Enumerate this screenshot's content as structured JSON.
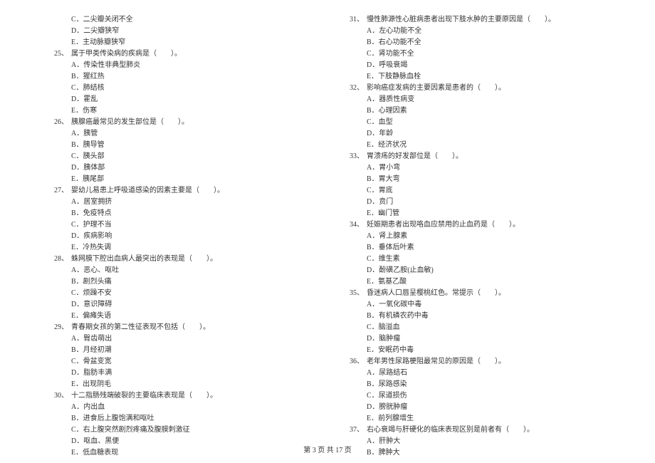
{
  "left": {
    "preOptions": [
      "C．二尖瓣关闭不全",
      "D．二尖瓣狭窄",
      "E．主动脉瓣狭窄"
    ],
    "questions": [
      {
        "num": "25、",
        "stem": "属于甲类传染病的疾病是（　　）。",
        "opts": [
          "A．传染性非典型肺炎",
          "B．猩红热",
          "C．肺结核",
          "D．霍乱",
          "E．伤寒"
        ]
      },
      {
        "num": "26、",
        "stem": "胰腺癌最常见的发生部位是（　　）。",
        "opts": [
          "A．胰管",
          "B．胰导管",
          "C．胰头部",
          "D．胰体部",
          "E．胰尾部"
        ]
      },
      {
        "num": "27、",
        "stem": "婴幼儿易患上呼吸道感染的因素主要是（　　）。",
        "opts": [
          "A．居室拥挤",
          "B．免疫特点",
          "C．护理不当",
          "D．疾病影响",
          "E．冷热失调"
        ]
      },
      {
        "num": "28、",
        "stem": "蛛网膜下腔出血病人最突出的表现是（　　）。",
        "opts": [
          "A．恶心、呕吐",
          "B．剧烈头痛",
          "C．烦躁不安",
          "D．意识障碍",
          "E．偏瘫失语"
        ]
      },
      {
        "num": "29、",
        "stem": "青春期女孩的第二性征表现不包括（　　）。",
        "opts": [
          "A．臀齿萌出",
          "B．月经初潮",
          "C．骨盆变宽",
          "D．脂肪丰满",
          "E．出现阴毛"
        ]
      },
      {
        "num": "30、",
        "stem": "十二指肠残端破裂的主要临床表现是（　　）。",
        "opts": [
          "A．内出血",
          "B．进食后上腹饱满和呕吐",
          "C．右上腹突然剧烈疼痛及腹膜刺激征",
          "D．呕血、黑便",
          "E．低血糖表现"
        ]
      }
    ]
  },
  "right": {
    "questions": [
      {
        "num": "31、",
        "stem": "慢性肺源性心脏病患者出现下肢水肿的主要原因是（　　）。",
        "opts": [
          "A．左心功能不全",
          "B．右心功能不全",
          "C．肾功能不全",
          "D．呼吸衰竭",
          "E．下肢静脉血栓"
        ]
      },
      {
        "num": "32、",
        "stem": "影响癌症发病的主要因素是患者的（　　）。",
        "opts": [
          "A．器质性病变",
          "B．心理因素",
          "C．血型",
          "D．年龄",
          "E．经济状况"
        ]
      },
      {
        "num": "33、",
        "stem": "胃溃疡的好发部位是（　　）。",
        "opts": [
          "A．胃小弯",
          "B．胃大弯",
          "C．胃底",
          "D．贲门",
          "E．幽门管"
        ]
      },
      {
        "num": "34、",
        "stem": "妊娠期患者出现咯血应禁用的止血药是（　　）。",
        "opts": [
          "A．肾上腺素",
          "B．垂体后叶素",
          "C．维生素",
          "D．酚磺乙胺(止血敏)",
          "E．氨基乙酸"
        ]
      },
      {
        "num": "35、",
        "stem": "昏迷病人口唇呈樱桃红色。常提示（　　）。",
        "opts": [
          "A．一氧化碳中毒",
          "B．有机磷农药中毒",
          "C．脑溢血",
          "D．脑肿瘤",
          "E．安眠药中毒"
        ]
      },
      {
        "num": "36、",
        "stem": "老年男性尿路梗阻最常见的原因是（　　）。",
        "opts": [
          "A．尿路结石",
          "B．尿路感染",
          "C．尿道损伤",
          "D．膀胱肿瘤",
          "E．前列腺增生"
        ]
      },
      {
        "num": "37、",
        "stem": "右心衰竭与肝硬化的临床表现区别是前者有（　　）。",
        "opts": [
          "A．肝肿大",
          "B．脾肿大"
        ]
      }
    ]
  },
  "footer": {
    "text": "第 3 页 共 17 页"
  }
}
